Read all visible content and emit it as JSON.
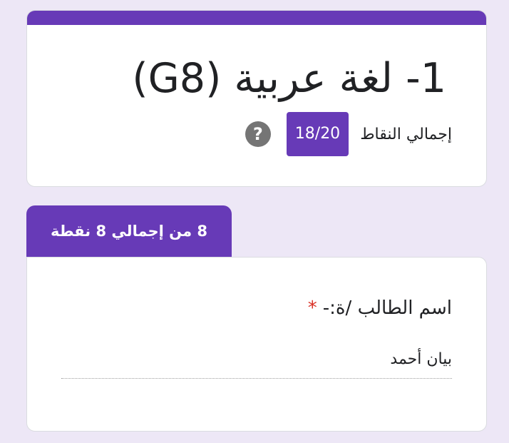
{
  "form": {
    "title": "1- لغة عربية (G8)",
    "score_label": "إجمالي النقاط",
    "score_value": "18/20",
    "help_icon": "help-circle-icon"
  },
  "section": {
    "tab_label": "8 من إجمالي 8 نقطة"
  },
  "question": {
    "label": "اسم الطالب /ة:-",
    "required_mark": "*",
    "answer": "بيان أحمد"
  },
  "colors": {
    "accent": "#673ab7",
    "background": "#ede7f6",
    "required": "#d93025",
    "help_icon": "#757575"
  }
}
